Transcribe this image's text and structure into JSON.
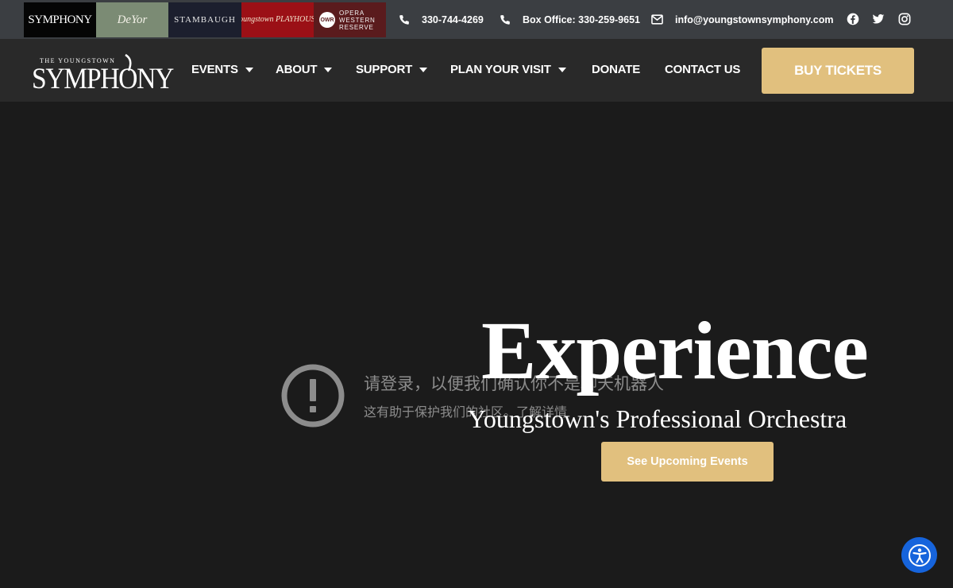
{
  "venues": [
    {
      "name": "venue-symphony",
      "text": "SYMPHONY"
    },
    {
      "name": "venue-deyor",
      "text": "DeYor"
    },
    {
      "name": "venue-stambaugh",
      "text": "STAMBAUGH"
    },
    {
      "name": "venue-playhouse",
      "text": "Youngstown PLAYHOUSE"
    },
    {
      "name": "venue-opera",
      "badge": "OWR",
      "text": "OPERA WESTERN RESERVE"
    }
  ],
  "contact": {
    "phone": "330-744-4269",
    "box_office": "Box Office: 330-259-9651",
    "email": "info@youngstownsymphony.com"
  },
  "social": [
    "facebook-icon",
    "twitter-icon",
    "instagram-icon"
  ],
  "logo": {
    "small": "THE YOUNGSTOWN",
    "big": "SYMPHONY"
  },
  "nav": {
    "events": "EVENTS",
    "about": "ABOUT",
    "support": "SUPPORT",
    "plan": "PLAN YOUR VISIT",
    "donate": "DONATE",
    "contact": "CONTACT US",
    "buy": "BUY TICKETS"
  },
  "captcha": {
    "line1": "请登录，以便我们确认你不是聊天机器人",
    "line2": "这有助于保护我们的社区。了解详情"
  },
  "hero": {
    "title": "Experience",
    "subtitle": "Youngstown's Professional Orchestra",
    "cta": "See Upcoming Events"
  },
  "colors": {
    "topbar": "#3b3e42",
    "navbar": "#292929",
    "hero_bg": "#1b1b1b",
    "gold": "#e1c07e",
    "accessibility_blue": "#1664dc"
  }
}
